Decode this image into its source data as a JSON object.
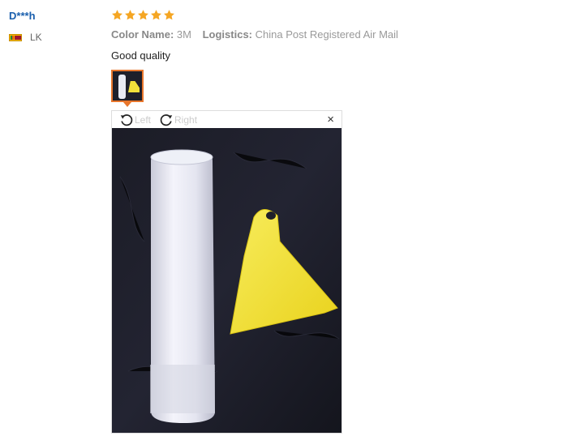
{
  "review": {
    "user": {
      "name": "D***h",
      "country": "LK",
      "flag_icon": "sri-lanka-flag-icon"
    },
    "rating": 5,
    "color_name_label": "Color Name:",
    "color_name_value": "3M",
    "logistics_label": "Logistics:",
    "logistics_value": "China Post Registered Air Mail",
    "comment": "Good quality",
    "star_color": "#f5a623"
  },
  "viewer": {
    "rotate_left_label": "Left",
    "rotate_right_label": "Right",
    "close_symbol": "×",
    "accent_color": "#e8762c"
  }
}
